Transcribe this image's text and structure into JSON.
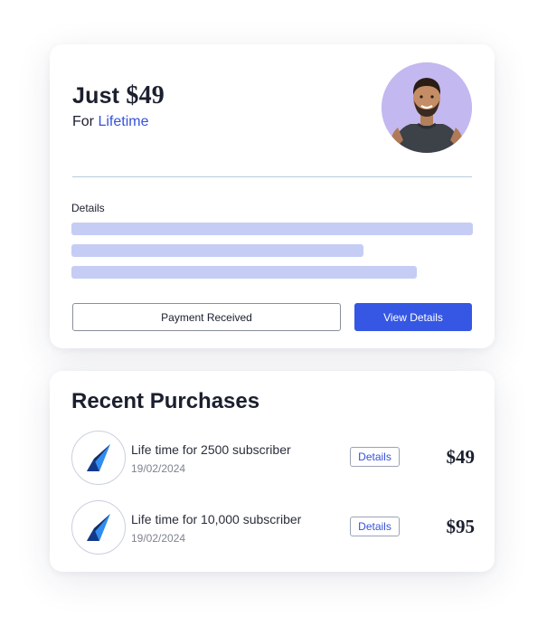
{
  "plan": {
    "price_prefix": "Just",
    "price_amount": "$49",
    "period_prefix": "For",
    "period_highlight": "Lifetime",
    "details_label": "Details",
    "payment_button": "Payment Received",
    "view_button": "View Details",
    "accent_color": "#3557e4"
  },
  "recent": {
    "title": "Recent Purchases",
    "items": [
      {
        "title": "Life time for 2500 subscriber",
        "date": "19/02/2024",
        "details_label": "Details",
        "price": "$49",
        "icon": "paper-plane-logo-icon"
      },
      {
        "title": "Life time for 10,000 subscriber",
        "date": "19/02/2024",
        "details_label": "Details",
        "price": "$95",
        "icon": "paper-plane-logo-icon"
      }
    ]
  }
}
